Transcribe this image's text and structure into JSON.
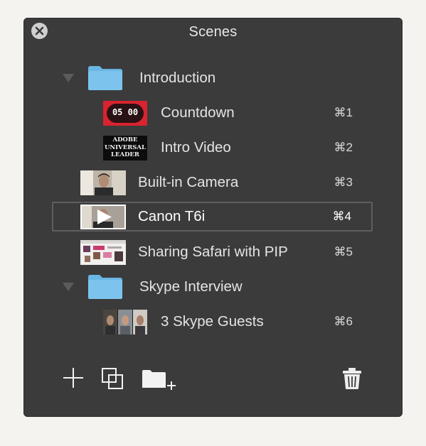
{
  "panel": {
    "title": "Scenes",
    "close_icon": "close-icon"
  },
  "scenes": [
    {
      "type": "folder",
      "label": "Introduction",
      "icon": "folder-icon",
      "expanded": true
    },
    {
      "type": "scene",
      "label": "Countdown",
      "shortcut": "⌘1",
      "thumb_text": "05 00"
    },
    {
      "type": "scene",
      "label": "Intro Video",
      "shortcut": "⌘2",
      "thumb_lines": [
        "ADOBE",
        "UNIVERSAL",
        "LEADER"
      ]
    },
    {
      "type": "scene",
      "label": "Built-in Camera",
      "shortcut": "⌘3"
    },
    {
      "type": "scene",
      "label": "Canon T6i",
      "shortcut": "⌘4",
      "selected": true
    },
    {
      "type": "scene",
      "label": "Sharing Safari with PIP",
      "shortcut": "⌘5"
    },
    {
      "type": "folder",
      "label": "Skype Interview",
      "icon": "folder-icon",
      "expanded": true
    },
    {
      "type": "scene",
      "label": "3 Skype Guests",
      "shortcut": "⌘6"
    }
  ],
  "toolbar": {
    "add_icon": "plus-icon",
    "duplicate_icon": "duplicate-icon",
    "new_folder_icon": "new-folder-icon",
    "delete_icon": "trash-icon"
  },
  "colors": {
    "panel_bg": "#3b3b3b",
    "folder_blue": "#7cc4ee",
    "selected_border": "#5e5e5e",
    "countdown_red": "#e02a3a"
  }
}
